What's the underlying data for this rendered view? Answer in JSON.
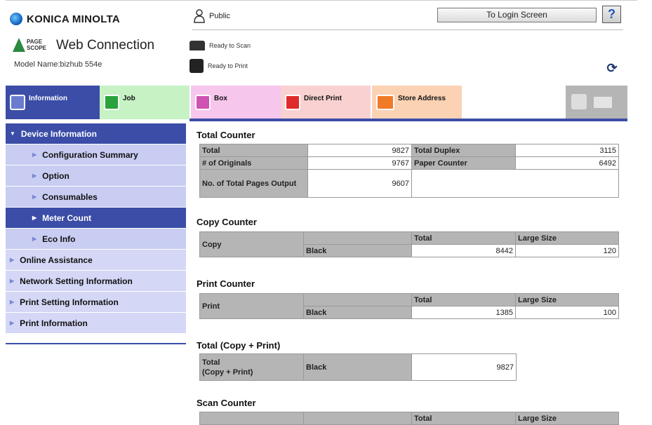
{
  "brand": {
    "name": "KONICA MINOLTA",
    "product_small": "PAGE\nSCOPE",
    "product": "Web Connection",
    "model": "Model Name:bizhub 554e"
  },
  "header": {
    "user": "Public",
    "login_button": "To Login Screen",
    "help": "?",
    "status_scan": "Ready to Scan",
    "status_print": "Ready to Print"
  },
  "tabs": {
    "information": "Information",
    "job": "Job",
    "box": "Box",
    "direct_print": "Direct Print",
    "store_address": "Store Address"
  },
  "sidebar": {
    "device_information": "Device Information",
    "items": [
      "Configuration Summary",
      "Option",
      "Consumables",
      "Meter Count",
      "Eco Info"
    ],
    "top_items": [
      "Online Assistance",
      "Network Setting Information",
      "Print Setting Information",
      "Print Information"
    ]
  },
  "total_counter": {
    "title": "Total Counter",
    "total_label": "Total",
    "total_value": "9827",
    "duplex_label": "Total Duplex",
    "duplex_value": "3115",
    "originals_label": "# of Originals",
    "originals_value": "9767",
    "paper_label": "Paper Counter",
    "paper_value": "6492",
    "pages_label": "No. of Total Pages Output",
    "pages_value": "9607"
  },
  "copy_counter": {
    "title": "Copy Counter",
    "row_label": "Copy",
    "total_header": "Total",
    "large_header": "Large Size",
    "color": "Black",
    "total": "8442",
    "large": "120"
  },
  "print_counter": {
    "title": "Print Counter",
    "row_label": "Print",
    "total_header": "Total",
    "large_header": "Large Size",
    "color": "Black",
    "total": "1385",
    "large": "100"
  },
  "total_copy_print": {
    "title": "Total (Copy + Print)",
    "row_label": "Total\n(Copy + Print)",
    "color": "Black",
    "total": "9827"
  },
  "scan_counter": {
    "title": "Scan Counter",
    "total_header": "Total",
    "large_header": "Large Size"
  }
}
